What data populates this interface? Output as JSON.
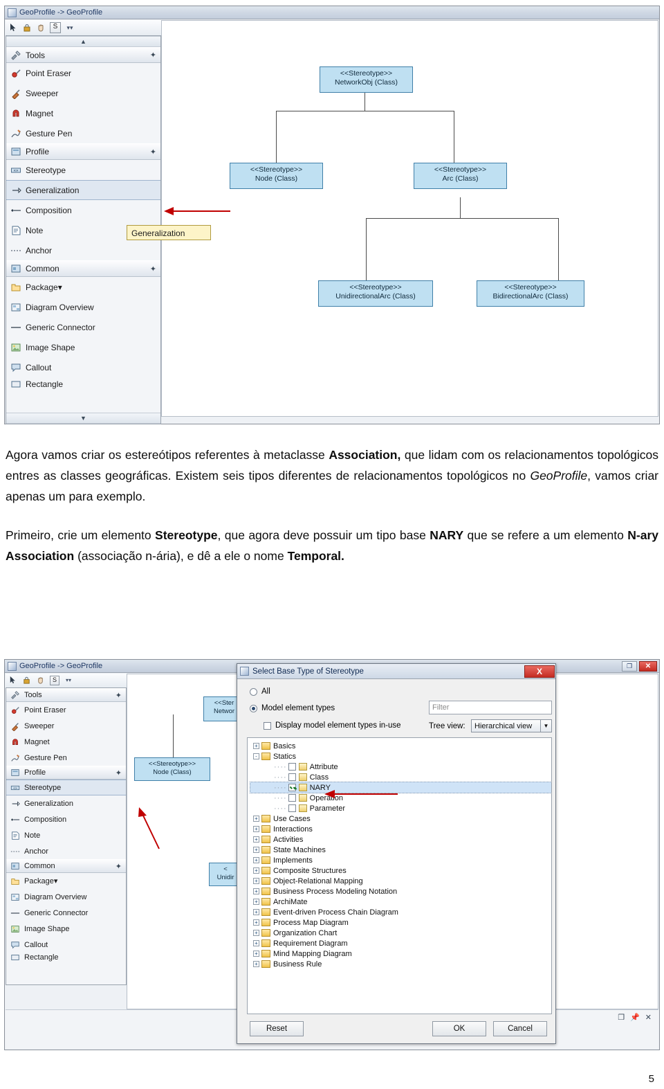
{
  "fig1": {
    "window_title": "GeoProfile -> GeoProfile",
    "toolbar_icons": [
      "pointer-icon",
      "lock-icon",
      "hand-icon",
      "s-icon",
      "chevron-down-icon"
    ],
    "toolbox": {
      "groups": [
        {
          "header": "Tools",
          "items": [
            "Point Eraser",
            "Sweeper",
            "Magnet",
            "Gesture Pen"
          ]
        },
        {
          "header": "Profile",
          "items": [
            "Stereotype",
            "Generalization",
            "Composition",
            "Note",
            "Anchor"
          ]
        },
        {
          "header": "Common",
          "items": [
            "Package",
            "Diagram Overview",
            "Generic Connector",
            "Image Shape",
            "Callout",
            "Rectangle"
          ]
        }
      ],
      "selected_item": "Generalization"
    },
    "tooltip": "Generalization",
    "classes": [
      {
        "stereotype": "<<Stereotype>>",
        "name": "NetworkObj (Class)"
      },
      {
        "stereotype": "<<Stereotype>>",
        "name": "Node (Class)"
      },
      {
        "stereotype": "<<Stereotype>>",
        "name": "Arc (Class)"
      },
      {
        "stereotype": "<<Stereotype>>",
        "name": "UnidirectionalArc (Class)"
      },
      {
        "stereotype": "<<Stereotype>>",
        "name": "BidirectionalArc (Class)"
      }
    ]
  },
  "text": {
    "p1_a": "Agora vamos criar os estereótipos referentes à metaclasse ",
    "p1_b": "Association,",
    "p1_c": " que lidam com os relacionamentos topológicos entres as classes geográficas. Existem seis tipos diferentes de relacionamentos topológicos no ",
    "p1_d": "GeoProfile",
    "p1_e": ", vamos criar apenas um para exemplo.",
    "p2_a": "Primeiro, crie um elemento ",
    "p2_b": "Stereotype",
    "p2_c": ", que agora deve possuir um tipo base ",
    "p2_d": "NARY",
    "p2_e": " que se refere a um elemento ",
    "p2_f": "N-ary Association",
    "p2_g": " (associação n-ária), e dê a ele o nome ",
    "p2_h": "Temporal."
  },
  "fig2": {
    "window_title": "GeoProfile -> GeoProfile",
    "window_buttons": [
      "restore-icon",
      "close-icon"
    ],
    "toolbox": {
      "groups": [
        {
          "header": "Tools",
          "items": [
            "Point Eraser",
            "Sweeper",
            "Magnet",
            "Gesture Pen"
          ]
        },
        {
          "header": "Profile",
          "items": [
            "Stereotype",
            "Generalization",
            "Composition",
            "Note",
            "Anchor"
          ]
        },
        {
          "header": "Common",
          "items": [
            "Package",
            "Diagram Overview",
            "Generic Connector",
            "Image Shape",
            "Callout",
            "Rectangle"
          ]
        }
      ],
      "selected_item": "Stereotype"
    },
    "classes": [
      {
        "stereotype": "<<Ster",
        "name": "Networ"
      },
      {
        "stereotype": "<<Stereotype>>",
        "name": "Node (Class)"
      },
      {
        "stereotype": "<",
        "name": "Unidir"
      }
    ],
    "statusbar_icons": [
      "restore-icon",
      "pin-icon",
      "close-icon"
    ],
    "dialog": {
      "title": "Select Base Type of Stereotype",
      "close_label": "X",
      "radio_all": "All",
      "radio_model": "Model element types",
      "checkbox_inuse": "Display model element types in-use",
      "filter_placeholder": "Filter",
      "tree_view_label": "Tree view:",
      "tree_view_value": "Hierarchical view",
      "tree": [
        {
          "label": "Basics",
          "type": "folder",
          "depth": 0,
          "expander": "+"
        },
        {
          "label": "Statics",
          "type": "folder",
          "depth": 0,
          "expander": "-"
        },
        {
          "label": "Attribute",
          "type": "leaf",
          "depth": 1,
          "checked": false
        },
        {
          "label": "Class",
          "type": "leaf",
          "depth": 1,
          "checked": false
        },
        {
          "label": "NARY",
          "type": "leaf",
          "depth": 1,
          "checked": true,
          "selected": true
        },
        {
          "label": "Operation",
          "type": "leaf",
          "depth": 1,
          "checked": false
        },
        {
          "label": "Parameter",
          "type": "leaf",
          "depth": 1,
          "checked": false
        },
        {
          "label": "Use Cases",
          "type": "folder",
          "depth": 0,
          "expander": "+"
        },
        {
          "label": "Interactions",
          "type": "folder",
          "depth": 0,
          "expander": "+"
        },
        {
          "label": "Activities",
          "type": "folder",
          "depth": 0,
          "expander": "+"
        },
        {
          "label": "State Machines",
          "type": "folder",
          "depth": 0,
          "expander": "+"
        },
        {
          "label": "Implements",
          "type": "folder",
          "depth": 0,
          "expander": "+"
        },
        {
          "label": "Composite Structures",
          "type": "folder",
          "depth": 0,
          "expander": "+"
        },
        {
          "label": "Object-Relational Mapping",
          "type": "folder",
          "depth": 0,
          "expander": "+"
        },
        {
          "label": "Business Process Modeling Notation",
          "type": "folder",
          "depth": 0,
          "expander": "+"
        },
        {
          "label": "ArchiMate",
          "type": "folder",
          "depth": 0,
          "expander": "+"
        },
        {
          "label": "Event-driven Process Chain Diagram",
          "type": "folder",
          "depth": 0,
          "expander": "+"
        },
        {
          "label": "Process Map Diagram",
          "type": "folder",
          "depth": 0,
          "expander": "+"
        },
        {
          "label": "Organization Chart",
          "type": "folder",
          "depth": 0,
          "expander": "+"
        },
        {
          "label": "Requirement Diagram",
          "type": "folder",
          "depth": 0,
          "expander": "+"
        },
        {
          "label": "Mind Mapping Diagram",
          "type": "folder",
          "depth": 0,
          "expander": "+"
        },
        {
          "label": "Business Rule",
          "type": "folder",
          "depth": 0,
          "expander": "+"
        }
      ],
      "buttons": {
        "reset": "Reset",
        "ok": "OK",
        "cancel": "Cancel"
      }
    }
  },
  "page_number": "5",
  "colors": {
    "accent_red": "#c00000",
    "uml_fill": "#bfe0f2",
    "uml_border": "#3f7fa8"
  }
}
